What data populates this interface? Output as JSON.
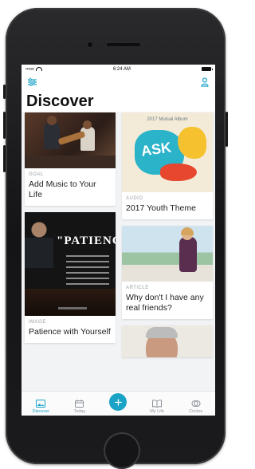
{
  "status": {
    "time": "6:24 AM",
    "signal": "•••oo"
  },
  "header": {
    "title": "Discover"
  },
  "cards": {
    "left": [
      {
        "eyebrow": "GOAL",
        "title": "Add Music to Your Life"
      },
      {
        "eyebrow": "IMAGE",
        "title": "Patience with Yourself",
        "image_text": "\"PATIENCE"
      }
    ],
    "right": [
      {
        "eyebrow": "AUDIO",
        "title": "2017 Youth Theme",
        "image_text": "2017 Mutual Album",
        "image_word": "ASK"
      },
      {
        "eyebrow": "ARTICLE",
        "title": "Why don't I have any real friends?"
      }
    ]
  },
  "tabs": [
    {
      "label": "Discover",
      "icon": "photo-icon",
      "active": true
    },
    {
      "label": "Today",
      "icon": "calendar-icon"
    },
    {
      "label": "",
      "icon": "plus-icon"
    },
    {
      "label": "My Life",
      "icon": "book-icon"
    },
    {
      "label": "Circles",
      "icon": "circles-icon"
    }
  ],
  "colors": {
    "accent": "#1aa3c7",
    "tab_inactive": "#8e949a"
  }
}
